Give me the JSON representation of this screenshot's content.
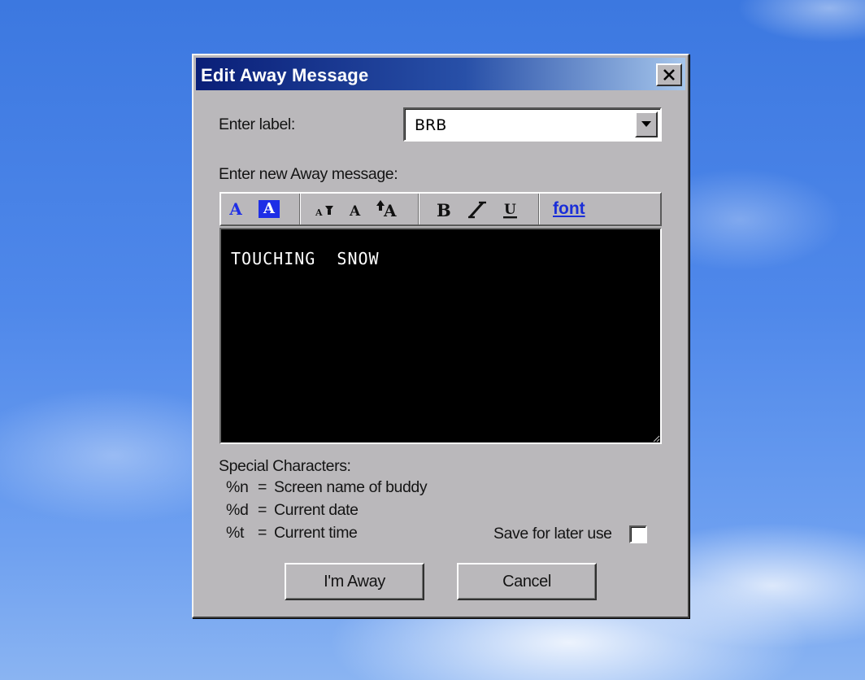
{
  "window": {
    "title": "Edit Away Message"
  },
  "label_field": {
    "label": "Enter label:",
    "value": "BRB"
  },
  "message_field": {
    "label": "Enter new Away message:",
    "text": "TOUCHING  SNOW"
  },
  "toolbar": {
    "text_color": "A",
    "background_color": "A",
    "font_link": "font",
    "accent_color": "#1e2ee6"
  },
  "special_characters": {
    "heading": "Special Characters:",
    "items": [
      {
        "code": "%n",
        "eq": "=",
        "desc": "Screen name of buddy"
      },
      {
        "code": "%d",
        "eq": "=",
        "desc": "Current date"
      },
      {
        "code": "%t",
        "eq": "=",
        "desc": "Current time"
      }
    ]
  },
  "save_option": {
    "label": "Save for later use",
    "checked": false
  },
  "buttons": {
    "away": "I'm Away",
    "cancel": "Cancel"
  }
}
